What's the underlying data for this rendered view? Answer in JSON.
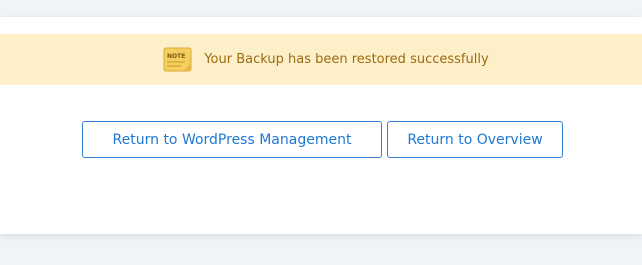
{
  "notice": {
    "icon": "note-icon",
    "icon_text": "NOTE",
    "message": "Your Backup has been restored successfully",
    "background_color": "#fdf0c8",
    "text_color": "#9c6a12"
  },
  "actions": {
    "wordpress_management_label": "Return to WordPress Management",
    "overview_label": "Return to Overview",
    "accent_color": "#1f78d1"
  }
}
